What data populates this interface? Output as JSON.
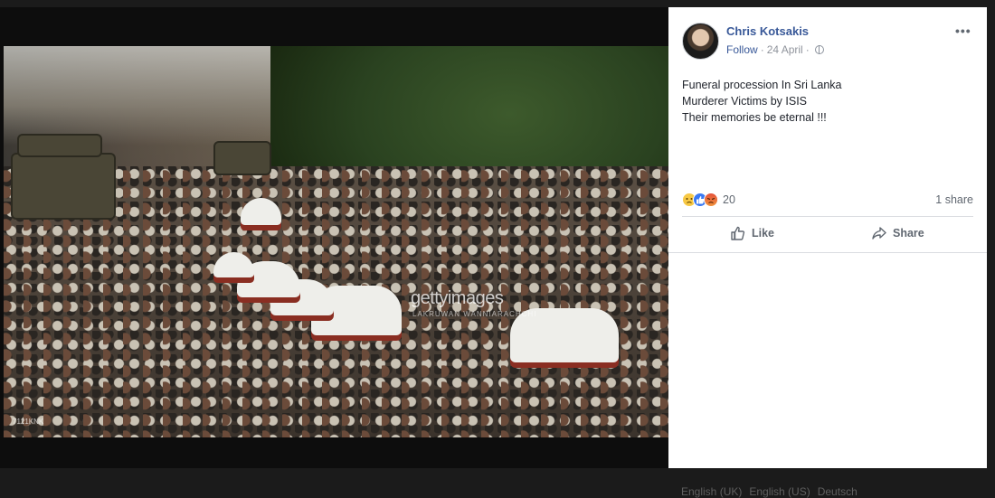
{
  "post": {
    "author": "Chris Kotsakis",
    "follow_label": "Follow",
    "separator": "·",
    "date": "24 April",
    "more_label": "•••",
    "text_lines": [
      "Funeral procession In Sri Lanka",
      "Murderer Victims by ISIS",
      "Their memories be eternal !!!"
    ],
    "reaction_count": "20",
    "shares_label": "1 share",
    "actions": {
      "like": "Like",
      "share": "Share"
    },
    "reaction_icons": [
      "sad-reaction-icon",
      "like-reaction-icon",
      "angry-reaction-icon"
    ]
  },
  "photo": {
    "watermark": "gettyimages",
    "watermark_credit": "LAKRUWAN WANNIARACHCHI",
    "image_id": "7121KNK"
  },
  "footer": {
    "languages": [
      "English (UK)",
      "English (US)",
      "Deutsch"
    ]
  },
  "colors": {
    "link": "#385898",
    "meta": "#90949c",
    "text": "#1d2129",
    "action": "#606770",
    "background": "#1b1b1b"
  }
}
